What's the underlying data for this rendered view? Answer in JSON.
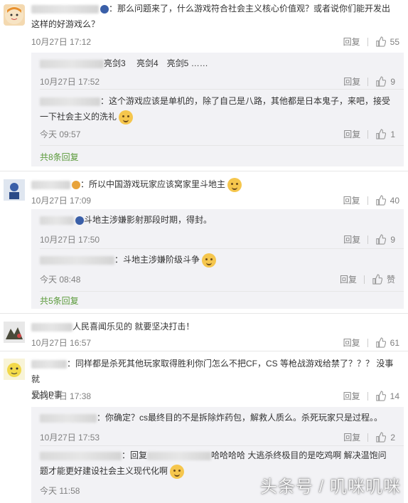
{
  "comments": [
    {
      "text1": "：那么问题来了，什么游戏符合社会主义核心价值观？或者说你们能开发出",
      "text2": "这样的好游戏么？",
      "time": "10月27日 17:12",
      "reply": "回复",
      "likes": "55",
      "replies": [
        {
          "text": "亮剑3　  亮剑4　亮剑5 ……",
          "time": "10月27日 17:52",
          "reply": "回复",
          "likes": "9"
        },
        {
          "text1": "：这个游戏应该是单机的，除了自己是八路，其他都是日本鬼子，来吧，接受",
          "text2": "一下社会主义的洗礼",
          "time": "今天 09:57",
          "reply": "回复",
          "likes": "1"
        }
      ],
      "more": "共8条回复"
    },
    {
      "text": "：所以中国游戏玩家应该窝家里斗地主",
      "time": "10月27日 17:09",
      "reply": "回复",
      "likes": "40",
      "replies": [
        {
          "text": "斗地主涉嫌影射那段时期，得封。",
          "time": "10月27日 17:50",
          "reply": "回复",
          "likes": "9"
        },
        {
          "text": "：斗地主涉嫌阶级斗争",
          "time": "今天 08:48",
          "reply": "回复",
          "likes": "赞"
        }
      ],
      "more": "共5条回复"
    },
    {
      "text": "人民喜闻乐见的 就要坚决打击！",
      "time": "10月27日 16:57",
      "reply": "回复",
      "likes": "61"
    },
    {
      "text1": "：同样都是杀死其他玩家取得胜利你门怎么不把CF，CS 等枪战游戏给禁了？？？ 没事就",
      "text2": "爱找P事",
      "time": "10月27日 17:38",
      "reply": "回复",
      "likes": "14",
      "replies": [
        {
          "text": "：你确定？cs最终目的不是拆除炸药包，解救人质么。杀死玩家只是过程。。",
          "time": "10月27日 17:53",
          "reply": "回复",
          "likes": "2"
        },
        {
          "text1": "：回复",
          "text1b": "哈哈哈哈 大逃杀终极目的是吃鸡啊 解决温饱问",
          "text2": "题才能更好建设社会主义现代化啊",
          "time": "今天 11:58"
        }
      ]
    }
  ],
  "watermark": "头条号 / 叽咪叽咪",
  "colors": {
    "link": "#5a9a3a",
    "meta": "#808080",
    "replyBg": "#f2f2f5"
  }
}
